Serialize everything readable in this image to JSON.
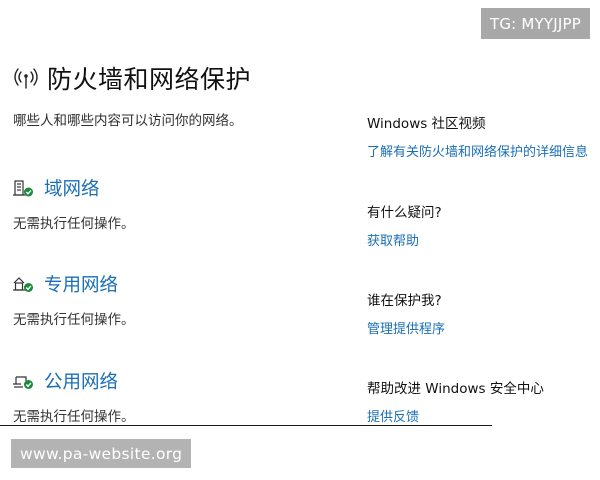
{
  "watermarks": {
    "tg": "TG: MYYJJPP",
    "url": "www.pa-website.org"
  },
  "header": {
    "icon": "wireless-broadcast-icon",
    "title": "防火墙和网络保护",
    "subtitle": "哪些人和哪些内容可以访问你的网络。"
  },
  "networks": [
    {
      "icon": "domain-network-icon",
      "title": "域网络",
      "status": "无需执行任何操作。",
      "status_color": "#1b8a3a"
    },
    {
      "icon": "private-network-icon",
      "title": "专用网络",
      "status": "无需执行任何操作。",
      "status_color": "#1b8a3a"
    },
    {
      "icon": "public-network-icon",
      "title": "公用网络",
      "status": "无需执行任何操作。",
      "status_color": "#1b8a3a"
    }
  ],
  "sidebar": {
    "community": {
      "heading": "Windows 社区视频",
      "link": "了解有关防火墙和网络保护的详细信息"
    },
    "help": {
      "heading": "有什么疑问?",
      "link": "获取帮助"
    },
    "protector": {
      "heading": "谁在保护我?",
      "link": "管理提供程序"
    },
    "feedback": {
      "heading": "帮助改进 Windows 安全中心",
      "link": "提供反馈"
    }
  },
  "colors": {
    "link": "#1a6fb5",
    "ok_badge": "#1b8a3a"
  }
}
